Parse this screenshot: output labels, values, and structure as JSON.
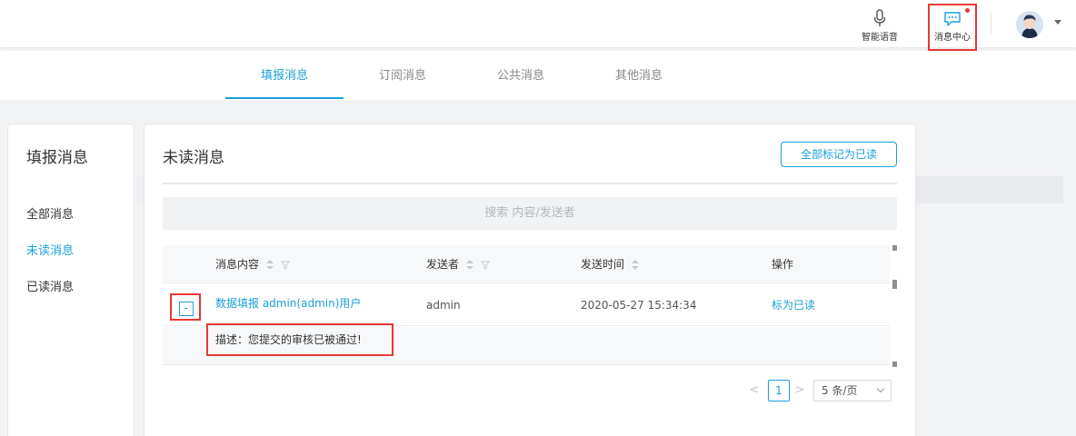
{
  "header": {
    "voice_label": "智能语音",
    "message_center_label": "消息中心",
    "voice_icon": "microphone-icon",
    "message_icon": "chat-bubble-icon",
    "notification_dot_color": "#e53935"
  },
  "tabs": [
    {
      "label": "填报消息",
      "active": true
    },
    {
      "label": "订阅消息",
      "active": false
    },
    {
      "label": "公共消息",
      "active": false
    },
    {
      "label": "其他消息",
      "active": false
    }
  ],
  "sidebar": {
    "title": "填报消息",
    "items": [
      {
        "label": "全部消息",
        "active": false
      },
      {
        "label": "未读消息",
        "active": true
      },
      {
        "label": "已读消息",
        "active": false
      }
    ]
  },
  "main": {
    "title": "未读消息",
    "mark_all_label": "全部标记为已读",
    "search_placeholder": "搜索 内容/发送者",
    "columns": [
      "消息内容",
      "发送者",
      "发送时间",
      "操作"
    ],
    "rows": [
      {
        "expand_symbol": "-",
        "content": "数据填报 admin(admin)用户",
        "sender": "admin",
        "time": "2020-05-27 15:34:34",
        "action": "标为已读",
        "detail": "描述：您提交的审核已被通过!"
      }
    ],
    "pagination": {
      "prev": "<",
      "current_page": "1",
      "next": ">",
      "page_size": "5 条/页"
    }
  },
  "colors": {
    "accent": "#1aa0d8",
    "highlight_box": "#e53935"
  }
}
